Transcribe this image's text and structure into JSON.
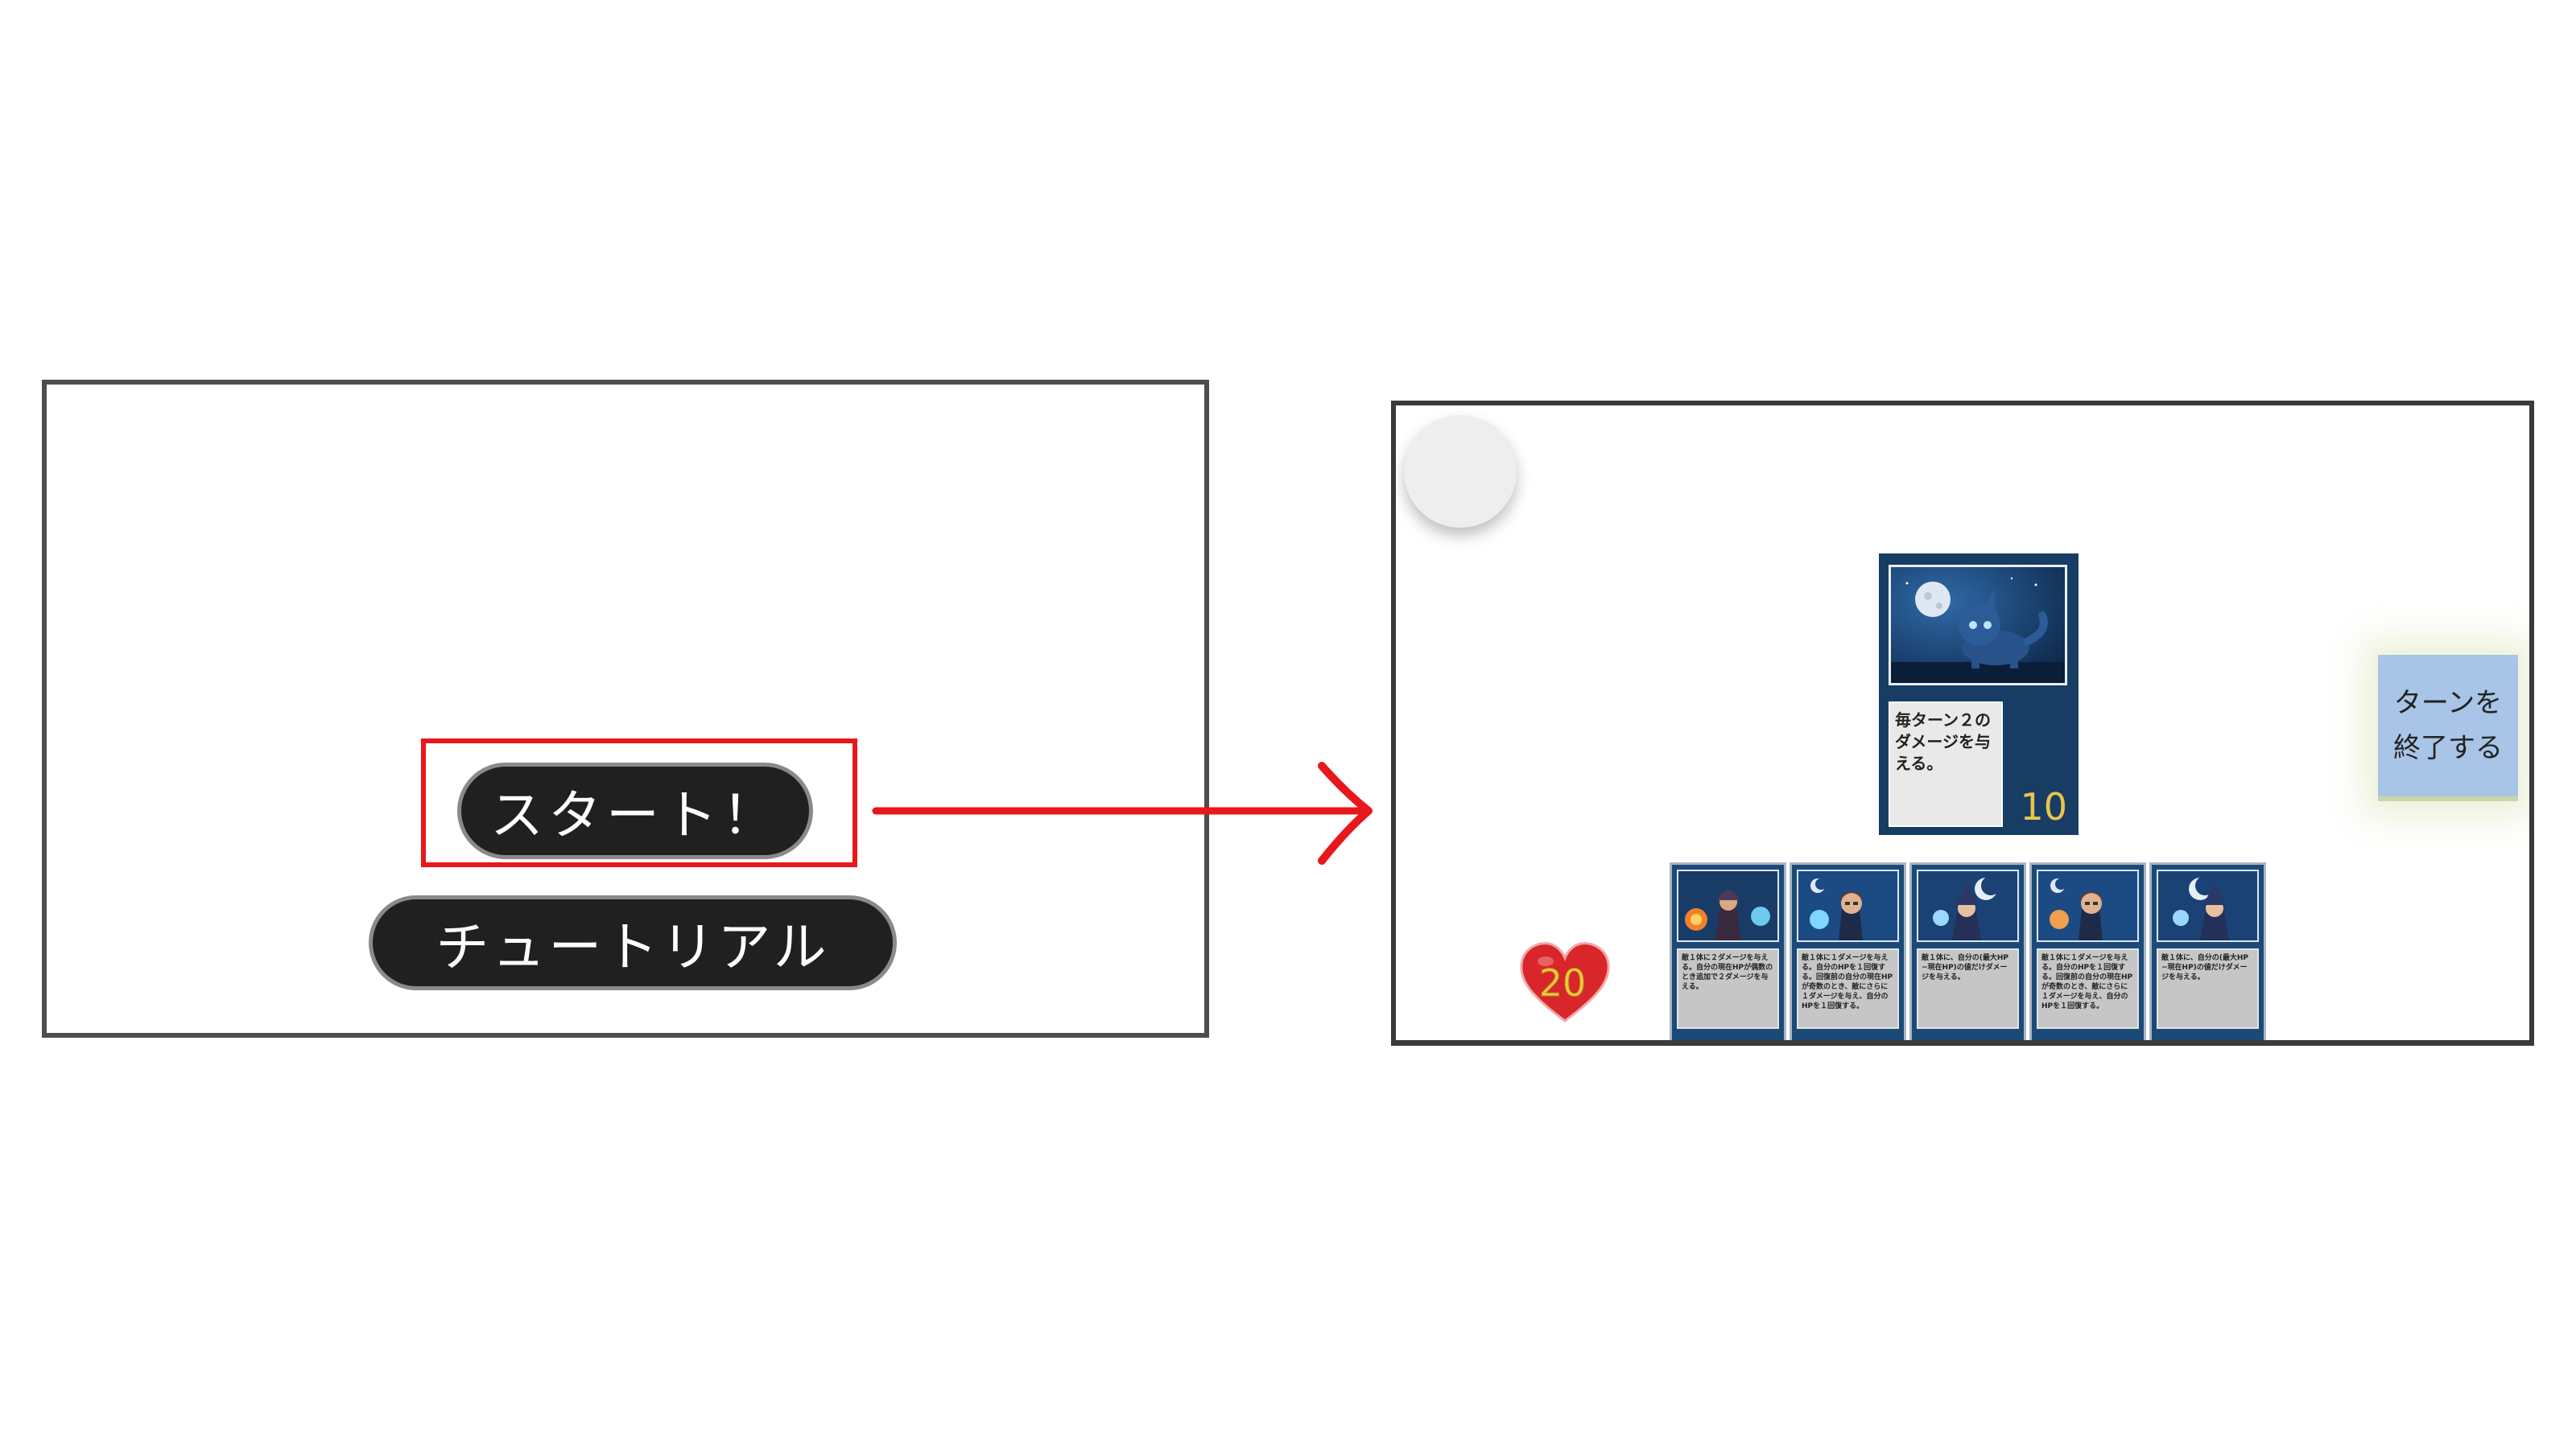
{
  "title_screen": {
    "start_label": "スタート！",
    "tutorial_label": "チュートリアル"
  },
  "colors": {
    "highlight": "#e8171b",
    "arrow": "#e8171b",
    "button_bg": "#202020",
    "card_blue": "#183d64",
    "end_turn_bg": "#a8c4e6",
    "heart": "#d8262a",
    "cost_text": "#e9c54a"
  },
  "game_screen": {
    "menu_button_icon": "menu-circle-icon",
    "field_card": {
      "art_icon": "moon-wolf-art",
      "description": "毎ターン２のダメージを与える。",
      "cost": "10"
    },
    "end_turn_button": {
      "line1": "ターンを",
      "line2": "終了する"
    },
    "life": {
      "icon": "heart-icon",
      "value": "20"
    },
    "hand": [
      {
        "art_icon": "fire-mage-art",
        "description": "敵１体に２ダメージを与える。自分の現在HPが偶数のとき追加で２ダメージを与える。"
      },
      {
        "art_icon": "ice-mage-art",
        "description": "敵１体に１ダメージを与える。自分のHPを１回復する。回復前の自分の現在HPが奇数のとき、敵にさらに１ダメージを与え、自分のHPを１回復する。"
      },
      {
        "art_icon": "moon-witch-art",
        "description": "敵１体に、自分の(最大HP−現在HP)の値だけダメージを与える。"
      },
      {
        "art_icon": "ice-mage-art",
        "description": "敵１体に１ダメージを与える。自分のHPを１回復する。回復前の自分の現在HPが奇数のとき、敵にさらに１ダメージを与え、自分のHPを１回復する。"
      },
      {
        "art_icon": "moon-witch-art",
        "description": "敵１体に、自分の(最大HP−現在HP)の値だけダメージを与える。"
      }
    ]
  }
}
